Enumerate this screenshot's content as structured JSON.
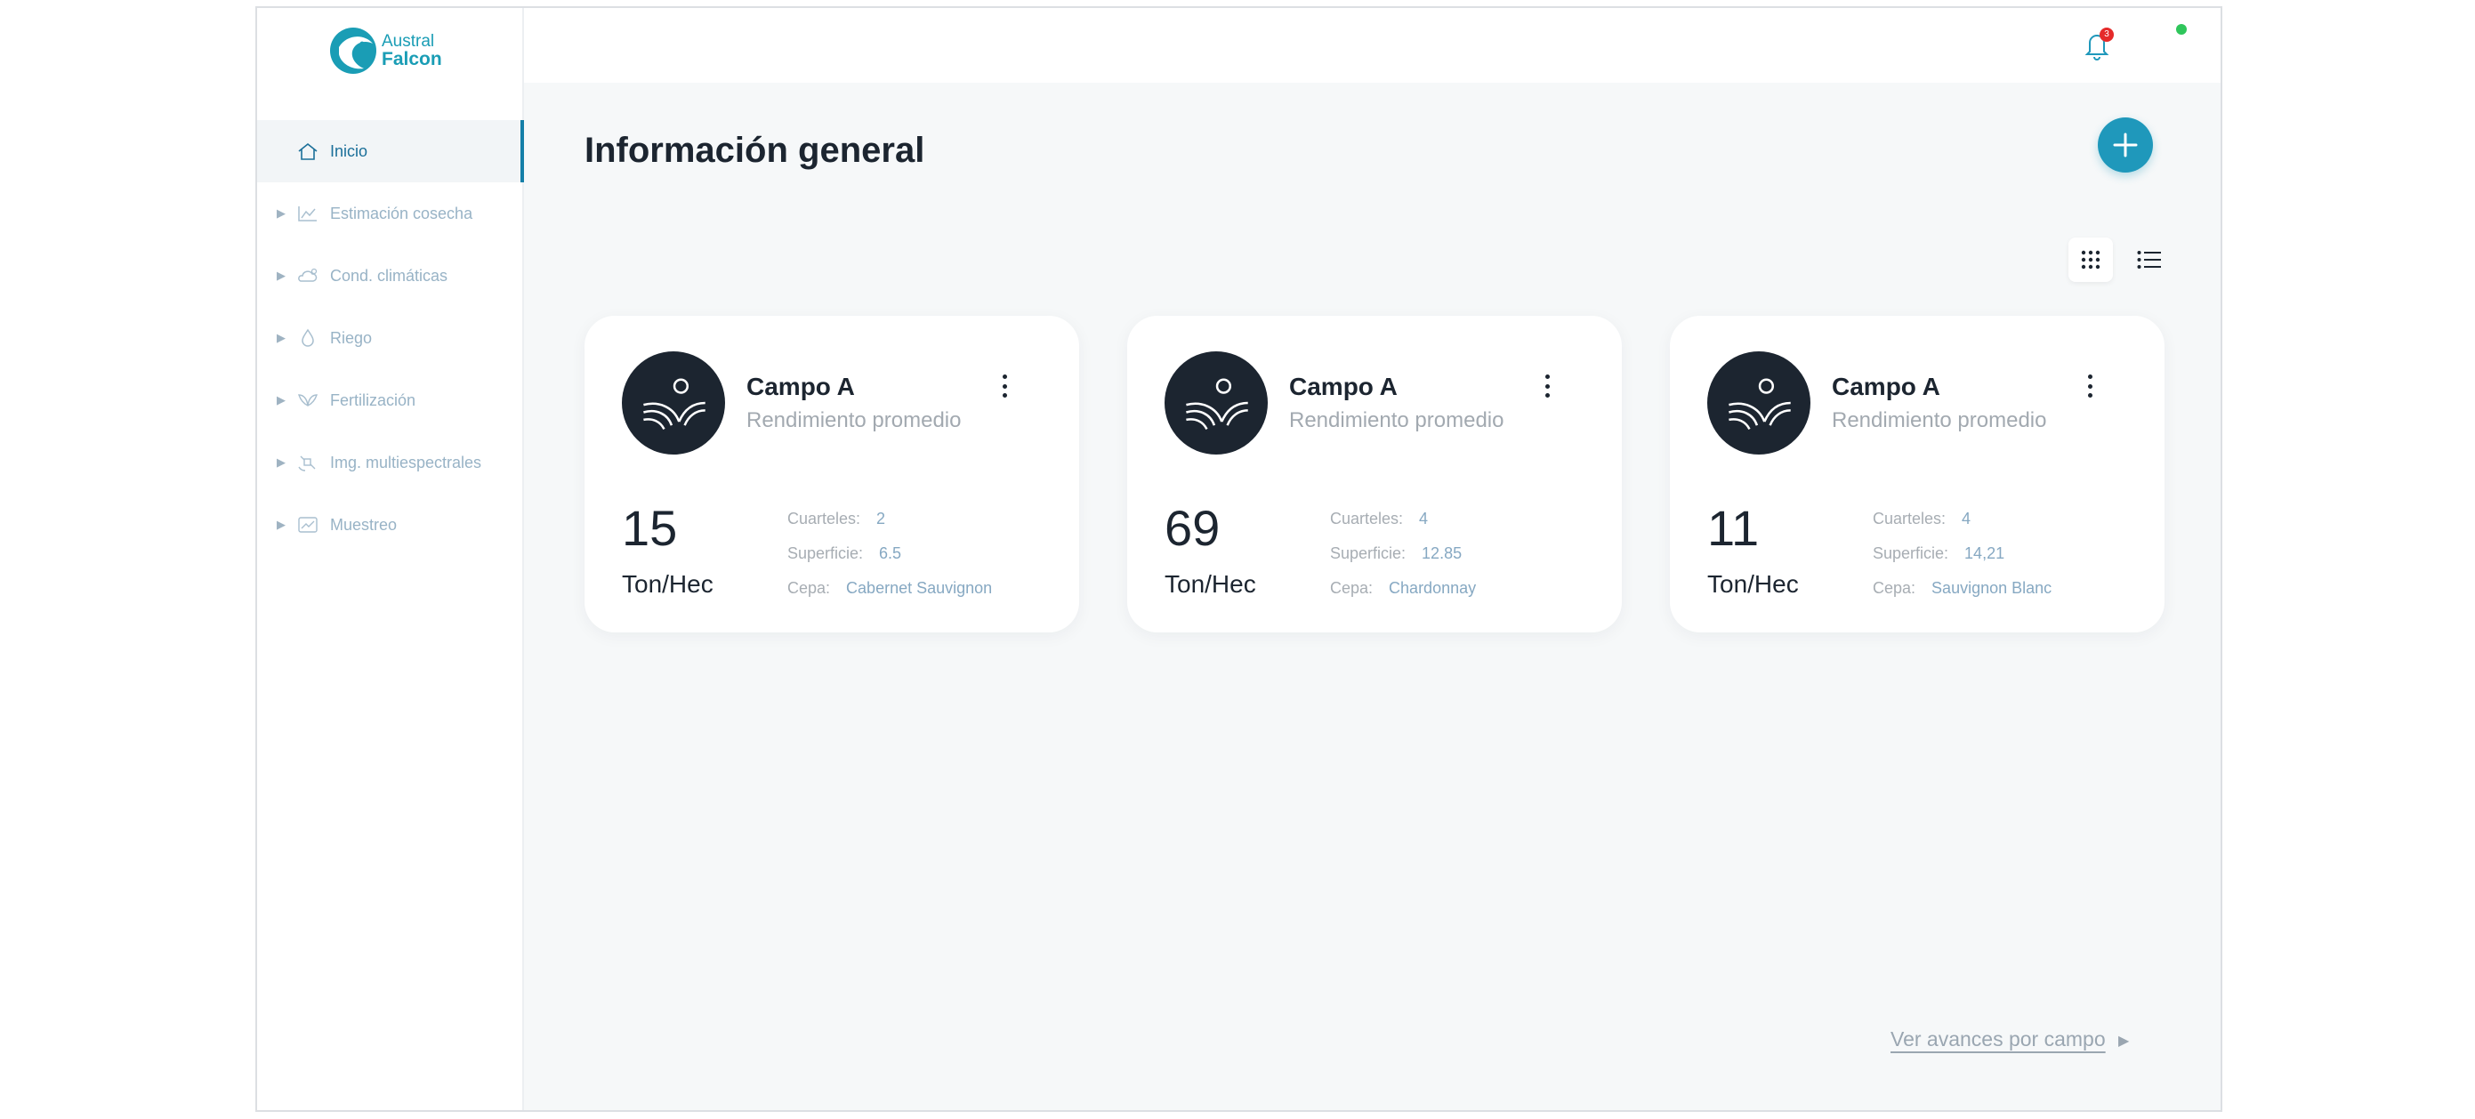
{
  "brand": {
    "line1": "Austral",
    "line2": "Falcon",
    "color": "#1a9db5"
  },
  "sidebar": {
    "items": [
      {
        "label": "Inicio",
        "icon": "home-icon",
        "active": true
      },
      {
        "label": "Estimación cosecha",
        "icon": "chart-icon"
      },
      {
        "label": "Cond. climáticas",
        "icon": "cloud-sun-icon"
      },
      {
        "label": "Riego",
        "icon": "drop-icon"
      },
      {
        "label": "Fertilización",
        "icon": "leaf-icon"
      },
      {
        "label": "Img. multiespectrales",
        "icon": "satellite-icon"
      },
      {
        "label": "Muestreo",
        "icon": "image-chart-icon"
      }
    ]
  },
  "header": {
    "notifications_count": "3"
  },
  "main": {
    "title": "Información general",
    "footer_link": "Ver avances por campo"
  },
  "cards": [
    {
      "name": "Campo A",
      "subtitle": "Rendimiento promedio",
      "value": "15",
      "unit": "Ton/Hec",
      "details": [
        {
          "k": "Cuarteles:",
          "v": "2"
        },
        {
          "k": "Superficie:",
          "v": "6.5"
        },
        {
          "k": "Cepa:",
          "v": "Cabernet Sauvignon"
        }
      ]
    },
    {
      "name": "Campo A",
      "subtitle": "Rendimiento promedio",
      "value": "69",
      "unit": "Ton/Hec",
      "details": [
        {
          "k": "Cuarteles:",
          "v": "4"
        },
        {
          "k": "Superficie:",
          "v": "12.85"
        },
        {
          "k": "Cepa:",
          "v": "Chardonnay"
        }
      ]
    },
    {
      "name": "Campo A",
      "subtitle": "Rendimiento promedio",
      "value": "11",
      "unit": "Ton/Hec",
      "details": [
        {
          "k": "Cuarteles:",
          "v": "4"
        },
        {
          "k": "Superficie:",
          "v": "14,21"
        },
        {
          "k": "Cepa:",
          "v": "Sauvignon Blanc"
        }
      ]
    }
  ],
  "colors": {
    "accent": "#1f98bb",
    "active_nav": "#147fa8",
    "status_online": "#2fc65b",
    "badge": "#e52a2a"
  }
}
